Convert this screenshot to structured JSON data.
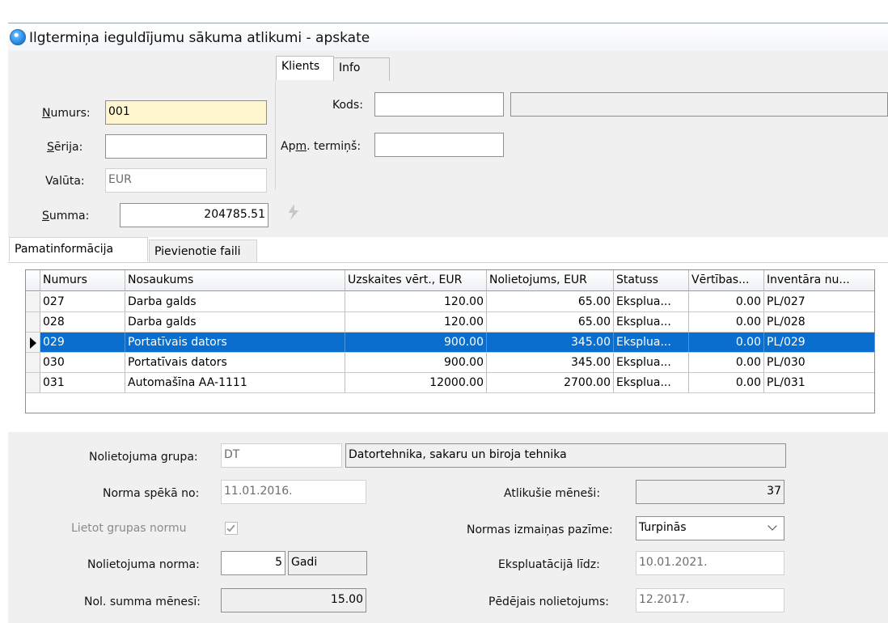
{
  "window": {
    "title": "Ilgtermiņa ieguldījumu sākuma atlikumi - apskate"
  },
  "header_form": {
    "numurs": {
      "label_acc": "N",
      "label_rest": "umurs:",
      "value": "001"
    },
    "serija": {
      "label_acc": "S",
      "label_rest": "ērija:",
      "value": ""
    },
    "valuta": {
      "label": "Valūta:",
      "value": "EUR"
    },
    "summa": {
      "label_acc": "S",
      "label_rest": "umma:",
      "value": "204785.51"
    }
  },
  "client_tabs": [
    {
      "label": "Klients"
    },
    {
      "label": "Info"
    }
  ],
  "client": {
    "kods": {
      "label": "Kods:",
      "value": "",
      "name": ""
    },
    "apm_termins": {
      "label_pre": "Ap",
      "label_acc": "m",
      "label_post": ". termiņš:",
      "value": ""
    }
  },
  "sub_tabs": [
    {
      "label": "Pamatinformācija"
    },
    {
      "label": "Pievienotie faili"
    }
  ],
  "grid": {
    "columns": [
      "Numurs",
      "Nosaukums",
      "Uzskaites vērt., EUR",
      "Nolietojums, EUR",
      "Statuss",
      "Vērtības...",
      "Inventāra nu..."
    ],
    "rows": [
      [
        "027",
        "Darba galds",
        "120.00",
        "65.00",
        "Eksplua...",
        "0.00",
        "PL/027"
      ],
      [
        "028",
        "Darba galds",
        "120.00",
        "65.00",
        "Eksplua...",
        "0.00",
        "PL/028"
      ],
      [
        "029",
        "Portatīvais dators",
        "900.00",
        "345.00",
        "Eksplua...",
        "0.00",
        "PL/029"
      ],
      [
        "030",
        "Portatīvais dators",
        "900.00",
        "345.00",
        "Eksplua...",
        "0.00",
        "PL/030"
      ],
      [
        "031",
        "Automašīna AA-1111",
        "12000.00",
        "2700.00",
        "Eksplua...",
        "0.00",
        "PL/031"
      ]
    ],
    "selected_row": 2
  },
  "details": {
    "nolietojuma_grupa": {
      "label": "Nolietojuma grupa:",
      "code": "DT",
      "name": "Datortehnika, sakaru un biroja tehnika"
    },
    "norma_speka_no": {
      "label": "Norma spēkā no:",
      "value": "11.01.2016."
    },
    "atlikusie_menesi": {
      "label": "Atlikušie mēneši:",
      "value": "37"
    },
    "lietot_grupas_normu": {
      "label": "Lietot grupas normu"
    },
    "normas_izmainas_pazime": {
      "label": "Normas izmaiņas pazīme:",
      "value": "Turpinās"
    },
    "nolietojuma_norma": {
      "label": "Nolietojuma norma:",
      "value": "5",
      "unit": "Gadi"
    },
    "ekspluatacija_lidz": {
      "label": "Ekspluatācijā līdz:",
      "value": "10.01.2021."
    },
    "nol_summa_menesi": {
      "label": "Nol. summa mēnesī:",
      "value": "15.00"
    },
    "pedejais_nolietojums": {
      "label": "Pēdējais nolietojums:",
      "value": "12.2017."
    }
  }
}
